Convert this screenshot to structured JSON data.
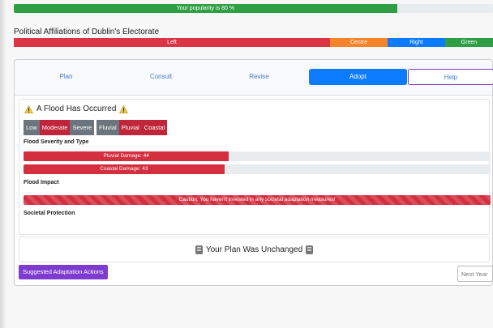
{
  "popularity": {
    "text": "Your popularity is 80 %",
    "value": 80
  },
  "affiliations": {
    "title": "Political Affiliations of Dublin's Electorate",
    "segments": [
      {
        "label": "Left",
        "share": 0.66,
        "color": "#dc3545"
      },
      {
        "label": "Centre",
        "share": 0.12,
        "color": "#f5842a"
      },
      {
        "label": "Right",
        "share": 0.12,
        "color": "#0d7bff"
      },
      {
        "label": "Green",
        "share": 0.1,
        "color": "#2f9e44"
      }
    ]
  },
  "tabs": {
    "plan": "Plan",
    "consult": "Consult",
    "revise": "Revise",
    "adopt": "Adopt",
    "help": "Help",
    "active": "Adopt"
  },
  "flood": {
    "title": "A Flood Has Occurred",
    "severity": {
      "low": "Low",
      "moderate": "Moderate",
      "severe": "Severe",
      "selected": "Moderate"
    },
    "types": {
      "fluvial": "Fluvial",
      "pluvial": "Pluvial",
      "coastal": "Coastal",
      "selected": [
        "Pluvial",
        "Coastal"
      ]
    },
    "severity_type_label": "Flood Severity and Type",
    "pluvial_damage_text": "Pluvial Damage: 44",
    "pluvial_damage": 44,
    "coastal_damage_text": "Coastal Damage: 43",
    "coastal_damage": 43,
    "impact_label": "Flood Impact",
    "caution_text": "Caution: You haven't invested in any societal adaptation measures!",
    "protection_label": "Societal Protection"
  },
  "plan_status": "Your Plan Was Unchanged",
  "buttons": {
    "suggested": "Suggested Adaptation Actions"
  },
  "next_year": {
    "placeholder": "Next Year"
  },
  "colors": {
    "warning": "#f2c94c",
    "danger": "#d32f3f",
    "primary": "#0d7bff",
    "purple": "#7e3bd1",
    "success": "#2f9e44"
  }
}
